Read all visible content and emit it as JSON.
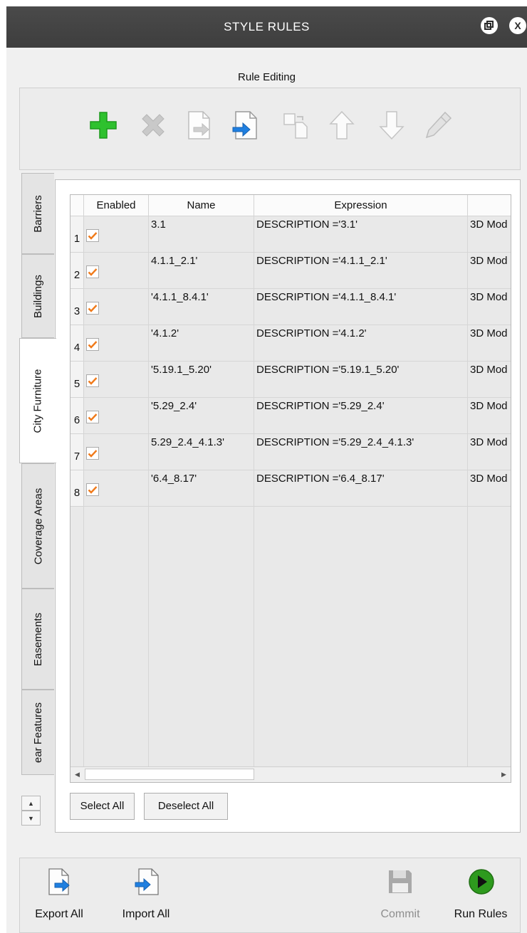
{
  "window": {
    "title": "STYLE RULES"
  },
  "rule_editing": {
    "label": "Rule Editing",
    "tools": [
      "add-icon",
      "delete-icon",
      "export-icon",
      "import-icon",
      "copy-icon",
      "move-up-icon",
      "move-down-icon",
      "edit-icon"
    ]
  },
  "tabs": [
    "Barriers",
    "Buildings",
    "City Furniture",
    "Coverage Areas",
    "Easements",
    "ear Features"
  ],
  "active_tab": "City Furniture",
  "table": {
    "headers": {
      "enabled": "Enabled",
      "name": "Name",
      "expression": "Expression",
      "extra": ""
    },
    "rows": [
      {
        "num": "1",
        "enabled": true,
        "name": "3.1",
        "expression": "DESCRIPTION ='3.1'",
        "extra": "3D Mod"
      },
      {
        "num": "2",
        "enabled": true,
        "name": "4.1.1_2.1'",
        "expression": "DESCRIPTION ='4.1.1_2.1'",
        "extra": "3D Mod"
      },
      {
        "num": "3",
        "enabled": true,
        "name": "'4.1.1_8.4.1'",
        "expression": "DESCRIPTION ='4.1.1_8.4.1'",
        "extra": "3D Mod"
      },
      {
        "num": "4",
        "enabled": true,
        "name": "'4.1.2'",
        "expression": "DESCRIPTION ='4.1.2'",
        "extra": "3D Mod"
      },
      {
        "num": "5",
        "enabled": true,
        "name": "'5.19.1_5.20'",
        "expression": "DESCRIPTION ='5.19.1_5.20'",
        "extra": "3D Mod"
      },
      {
        "num": "6",
        "enabled": true,
        "name": "'5.29_2.4'",
        "expression": "DESCRIPTION ='5.29_2.4'",
        "extra": "3D Mod"
      },
      {
        "num": "7",
        "enabled": true,
        "name": "5.29_2.4_4.1.3'",
        "expression": "DESCRIPTION ='5.29_2.4_4.1.3'",
        "extra": "3D Mod"
      },
      {
        "num": "8",
        "enabled": true,
        "name": "'6.4_8.17'",
        "expression": "DESCRIPTION ='6.4_8.17'",
        "extra": "3D Mod"
      }
    ]
  },
  "buttons": {
    "select_all": "Select All",
    "deselect_all": "Deselect All"
  },
  "bottom": {
    "export_all": "Export All",
    "import_all": "Import All",
    "commit": "Commit",
    "run_rules": "Run Rules"
  },
  "colors": {
    "titlebar": "#404040",
    "check": "#f07a1a",
    "add": "#2ec12e",
    "import_arrow": "#1f7fe0",
    "run": "#2e9a1e"
  }
}
